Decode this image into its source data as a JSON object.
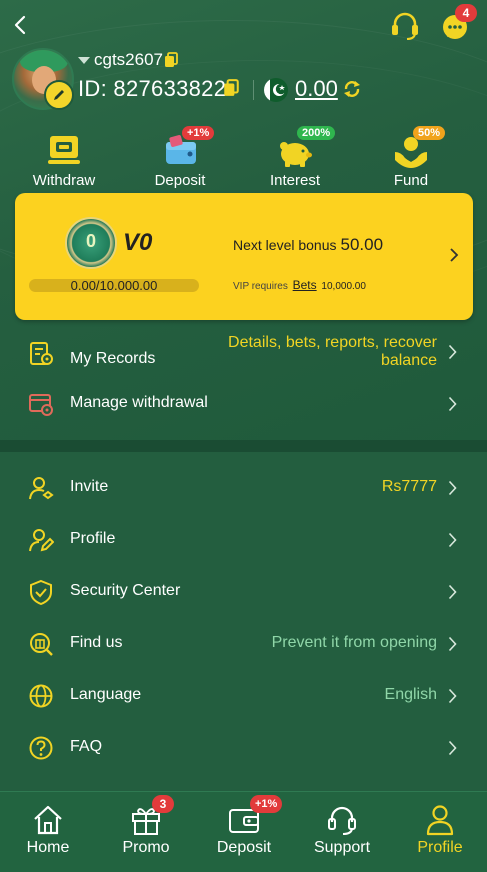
{
  "header": {
    "notification_count": "4"
  },
  "user": {
    "username": "cgts2607",
    "id_text": "ID: 827633822",
    "balance": "0.00"
  },
  "quick_actions": [
    {
      "label": "Withdraw",
      "badge": ""
    },
    {
      "label": "Deposit",
      "badge": "+1%"
    },
    {
      "label": "Interest",
      "badge": "200%"
    },
    {
      "label": "Fund",
      "badge": "50%"
    }
  ],
  "vip": {
    "level": "V0",
    "medal_text": "0",
    "progress_text": "0.00/10.000.00",
    "progress_fraction": 0,
    "next_bonus_label": "Next level bonus",
    "next_bonus_value": "50.00",
    "requires_label": "VIP requires",
    "requires_link": "Bets",
    "requires_value": "10,000.00"
  },
  "menu_top": [
    {
      "label": "My Records",
      "value": "Details, bets, reports, recover balance",
      "icon": "records-icon"
    },
    {
      "label": "Manage withdrawal",
      "value": "",
      "icon": "withdrawal-card-icon"
    }
  ],
  "menu_main": [
    {
      "label": "Invite",
      "value": "Rs7777",
      "icon": "invite-user-icon"
    },
    {
      "label": "Profile",
      "value": "",
      "icon": "profile-edit-icon"
    },
    {
      "label": "Security Center",
      "value": "",
      "icon": "shield-check-icon"
    },
    {
      "label": "Find us",
      "value": "Prevent it from opening",
      "icon": "search-building-icon"
    },
    {
      "label": "Language",
      "value": "English",
      "icon": "globe-icon"
    },
    {
      "label": "FAQ",
      "value": "",
      "icon": "question-icon"
    }
  ],
  "bottom_nav": [
    {
      "label": "Home",
      "badge": ""
    },
    {
      "label": "Promo",
      "badge": "3"
    },
    {
      "label": "Deposit",
      "badge": "+1%"
    },
    {
      "label": "Support",
      "badge": ""
    },
    {
      "label": "Profile",
      "badge": ""
    }
  ],
  "colors": {
    "background": "#235e3f",
    "accent_yellow": "#f1d424",
    "vip_card": "#fcd21f",
    "badge_red": "#e23b3b",
    "value_green": "#8fd6a8"
  }
}
